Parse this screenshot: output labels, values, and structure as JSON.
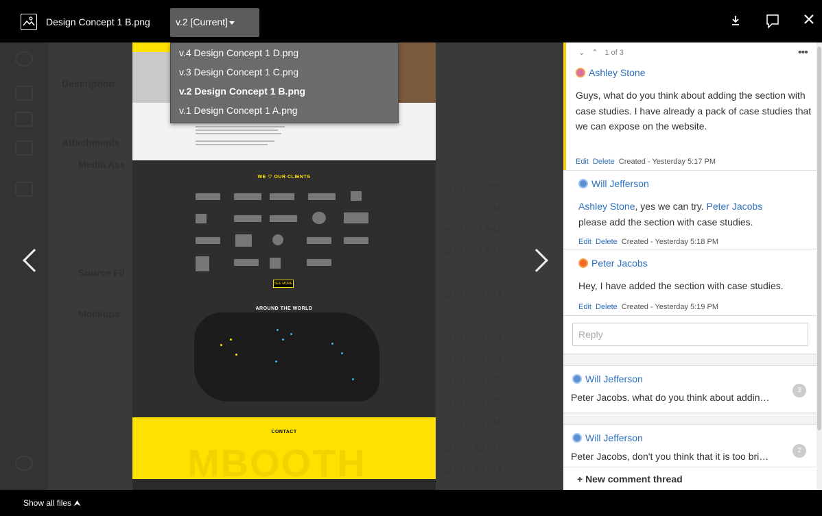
{
  "topbar": {
    "file_name": "Design Concept 1 B.png",
    "version_label": "v.2 [Current]",
    "icons": [
      "image-file-icon",
      "download-icon",
      "comment-icon",
      "close-icon"
    ]
  },
  "version_menu": {
    "items": [
      {
        "label": "v.4 Design Concept 1 D.png",
        "active": false
      },
      {
        "label": "v.3 Design Concept 1 C.png",
        "active": false
      },
      {
        "label": "v.2 Design Concept 1 B.png",
        "active": true
      },
      {
        "label": "v.1 Design Concept 1 A.png",
        "active": false
      }
    ]
  },
  "preview": {
    "clients_heading": "WE ♡ OUR CLIENTS",
    "see_more": "SEE MORE",
    "world_heading": "AROUND THE WORLD",
    "contact_heading": "CONTACT",
    "watermark": "MBOOTH"
  },
  "background": {
    "labels": [
      "Description",
      "Attachments",
      "Media Ass",
      "Source Fil",
      "Mockups"
    ],
    "dates": [
      "sp/16 5:11 PM",
      "sp/16 5:11 PM",
      "sp/16 5:11 PM",
      "sp/16 5:11 PM",
      "sp/16 5:15 PM",
      "sp/16 4:18 PM",
      "sp/16 4:18 PM",
      "sp/16 4:18 PM",
      "sp/16 4:13 PM",
      "sp/16 4:13 PM",
      "sp/16 4:33 PM",
      "sp/16 4:33 PM"
    ]
  },
  "comments": {
    "pager": "1 of 3",
    "active_thread": [
      {
        "author": "Ashley Stone",
        "body": "Guys, what do you think about adding the section with case studies. I have already a pack of case studies that we can expose on the website.",
        "edit": "Edit",
        "delete": "Delete",
        "created": "Created - Yesterday 5:17 PM"
      },
      {
        "author": "Will Jefferson",
        "mention1": "Ashley Stone",
        "text1": ", yes we can try. ",
        "mention2": "Peter Jacobs",
        "text2": "please add the section with case studies.",
        "edit": "Edit",
        "delete": "Delete",
        "created": "Created - Yesterday 5:18 PM"
      },
      {
        "author": "Peter Jacobs",
        "body": "Hey, I have added the section with case studies.",
        "edit": "Edit",
        "delete": "Delete",
        "created": "Created - Yesterday 5:19 PM"
      }
    ],
    "reply_placeholder": "Reply",
    "other_threads": [
      {
        "author": "Will Jefferson",
        "preview": "Peter Jacobs. what do you think about addin…",
        "count": "3"
      },
      {
        "author": "Will Jefferson",
        "preview": "Peter Jacobs, don't you think that it is too bri…",
        "count": "2"
      }
    ],
    "new_thread": "+ New comment thread"
  },
  "bottombar": {
    "show_files": "Show all files ⮝"
  }
}
